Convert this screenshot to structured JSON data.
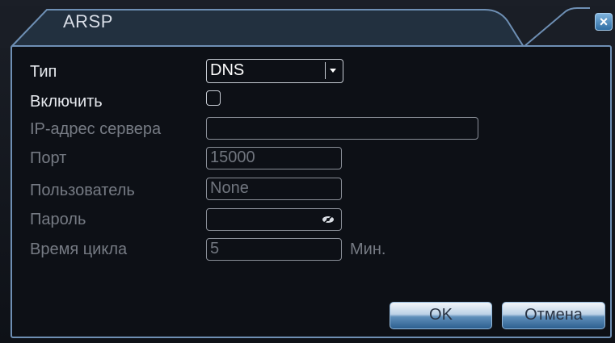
{
  "window": {
    "title": "ARSP",
    "close_label": "×"
  },
  "form": {
    "type": {
      "label": "Тип",
      "value": "DNS"
    },
    "enable": {
      "label": "Включить",
      "checked": false
    },
    "server_ip": {
      "label": "IP-адрес сервера",
      "value": ""
    },
    "port": {
      "label": "Порт",
      "value": "15000"
    },
    "user": {
      "label": "Пользователь",
      "value": "None"
    },
    "password": {
      "label": "Пароль",
      "value": ""
    },
    "cycle": {
      "label": "Время цикла",
      "value": "5",
      "unit": "Мин."
    }
  },
  "buttons": {
    "ok_label": "OK",
    "cancel_label": "Отмена"
  },
  "icons": {
    "password_toggle": "eye-slash-icon",
    "close": "close-icon",
    "dropdown": "chevron-down-icon"
  },
  "colors": {
    "panel_border": "#6e8fb4",
    "active_text": "#e6e9ee",
    "disabled_text": "#767b84",
    "button_accent": "#2d5f8f"
  }
}
